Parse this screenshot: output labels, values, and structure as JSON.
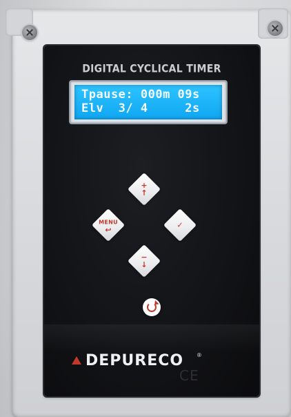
{
  "device": {
    "title": "DIGITAL CYCLICAL TIMER",
    "lcd": {
      "line1": "Tpause: 000m 09s",
      "line2": "Elv  3/ 4     2s",
      "backlight_color": "#1fb4fb",
      "text_color": "#f3fbff"
    },
    "keys": {
      "up": {
        "glyph": "+"
      },
      "down": {
        "glyph": "−"
      },
      "menu": {
        "label": "MENU"
      },
      "ok": {
        "glyph": "✓"
      }
    },
    "brand": {
      "name": "DEPURECO",
      "reg_mark": "®"
    },
    "certification": "CE",
    "accent_color": "#c0392b",
    "panel_color": "#121316"
  }
}
